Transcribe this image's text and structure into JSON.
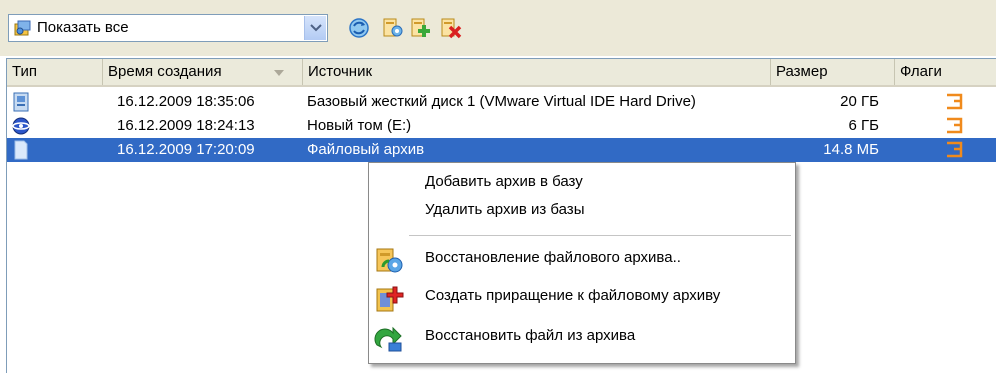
{
  "toolbar": {
    "filter_value": "Показать все",
    "icons": [
      "refresh-icon",
      "archive-settings-icon",
      "add-archive-icon",
      "delete-archive-icon"
    ]
  },
  "columns": [
    {
      "label": "Тип"
    },
    {
      "label": "Время создания"
    },
    {
      "label": "Источник"
    },
    {
      "label": "Размер"
    },
    {
      "label": "Флаги"
    }
  ],
  "rows": [
    {
      "type_icon": "disk-image-icon",
      "created": "16.12.2009 18:35:06",
      "source": "Базовый жесткий диск 1 (VMware Virtual IDE Hard Drive)",
      "size": "20 ГБ",
      "flag_icon": "flag-icon",
      "selected": false
    },
    {
      "type_icon": "volume-image-icon",
      "created": "16.12.2009 18:24:13",
      "source": "Новый том (E:)",
      "size": "6 ГБ",
      "flag_icon": "flag-icon",
      "selected": false
    },
    {
      "type_icon": "file-archive-icon",
      "created": "16.12.2009 17:20:09",
      "source": "Файловый архив",
      "size": "14.8 МБ",
      "flag_icon": "flag-icon",
      "selected": true
    }
  ],
  "context_menu": {
    "items": [
      {
        "label": "Добавить архив в базу"
      },
      {
        "label": "Удалить архив из базы"
      },
      {
        "label": "Восстановление файлового архива..",
        "icon": "restore-archive-icon"
      },
      {
        "label": "Создать приращение к файловому архиву",
        "icon": "create-increment-icon"
      },
      {
        "label": "Восстановить файл из архива",
        "icon": "restore-file-icon"
      }
    ]
  },
  "colors": {
    "selection": "#316ac5",
    "header_bg": "#ebeadb",
    "toolbar_bg": "#ece9d8",
    "flag_orange": "#f08a1c"
  }
}
